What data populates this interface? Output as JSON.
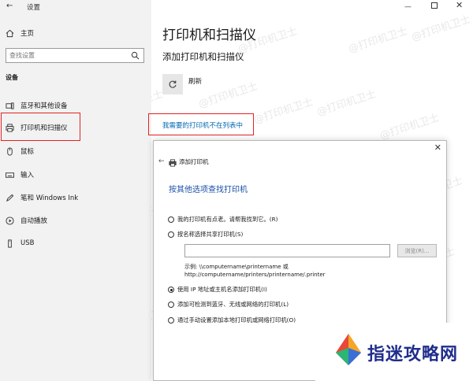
{
  "window": {
    "app_title": "设置",
    "minimize": "—",
    "close": "✕"
  },
  "sidebar": {
    "home_label": "主页",
    "search_placeholder": "查找设置",
    "section_label": "设备",
    "items": [
      {
        "label": "蓝牙和其他设备",
        "icon": "bluetooth-devices-icon"
      },
      {
        "label": "打印机和扫描仪",
        "icon": "printer-icon",
        "selected": true
      },
      {
        "label": "鼠标",
        "icon": "mouse-icon"
      },
      {
        "label": "输入",
        "icon": "keyboard-icon"
      },
      {
        "label": "笔和 Windows Ink",
        "icon": "pen-icon"
      },
      {
        "label": "自动播放",
        "icon": "autoplay-icon"
      },
      {
        "label": "USB",
        "icon": "usb-icon"
      }
    ]
  },
  "main": {
    "title": "打印机和扫描仪",
    "subtitle": "添加打印机和扫描仪",
    "refresh_label": "刷新",
    "not_listed_link": "我需要的打印机不在列表中"
  },
  "dialog": {
    "title": "添加打印机",
    "heading": "按其他选项查找打印机",
    "options": [
      {
        "label": "我的打印机有点老。请帮我找到它。(R)",
        "checked": false
      },
      {
        "label": "按名称选择共享打印机(S)",
        "checked": false
      },
      {
        "label": "使用 IP 地址或主机名添加打印机(I)",
        "checked": true
      },
      {
        "label": "添加可检测到蓝牙、无线或网络的打印机(L)",
        "checked": false
      },
      {
        "label": "通过手动设置添加本地打印机或网络打印机(O)",
        "checked": false
      }
    ],
    "browse_label": "浏览(R)...",
    "example_line1": "示例: \\\\computername\\printername 或",
    "example_line2": "http://computername/printers/printername/.printer"
  },
  "watermark": "@打印机卫士",
  "logo": {
    "text": "指迷攻略网"
  },
  "colors": {
    "accent_link": "#0066b4",
    "highlight_red": "#e32222",
    "sidebar_bg": "#f2f2f2",
    "logo_blue": "#1f2d8c"
  }
}
